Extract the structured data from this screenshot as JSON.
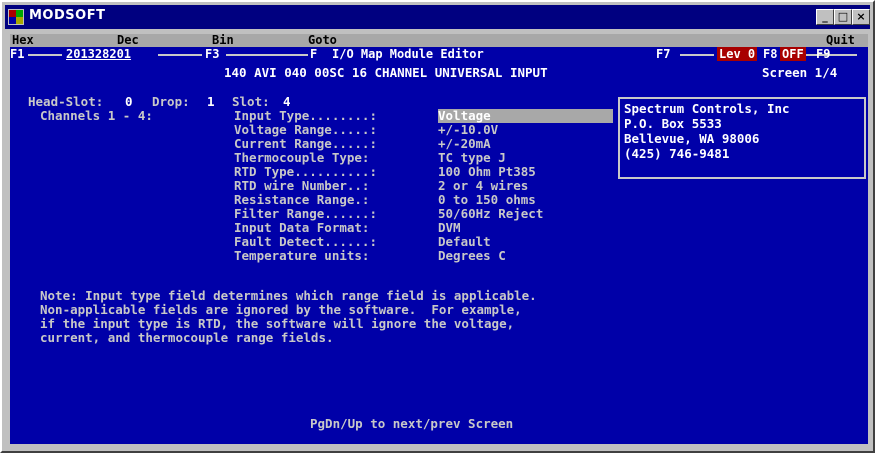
{
  "window": {
    "title": "MODSOFT",
    "minimize": "_",
    "maximize": "□",
    "close": "×"
  },
  "menu": {
    "hex": "Hex",
    "dec": "Dec",
    "bin": "Bin",
    "goto": "Goto",
    "quit": "Quit"
  },
  "keys": {
    "f1": "F1",
    "f1_value": "201328201",
    "f3": "F3",
    "f5": "F",
    "editor_title": "I/O Map Module Editor",
    "f7": "F7",
    "lev": "Lev 0",
    "f8": "F8",
    "off": "OFF",
    "f9": "F9"
  },
  "header": {
    "module": "140 AVI 040 00SC 16 CHANNEL UNIVERSAL INPUT",
    "screen": "Screen 1/4"
  },
  "location": {
    "head_slot_label": "Head-Slot:",
    "head_slot": "0",
    "drop_label": "Drop:",
    "drop": "1",
    "slot_label": "Slot:",
    "slot": "4",
    "channels": "Channels 1 - 4:"
  },
  "fields": [
    {
      "label": "Input Type........:",
      "value": "Voltage"
    },
    {
      "label": "Voltage Range.....:",
      "value": "+/-10.0V"
    },
    {
      "label": "Current Range.....:",
      "value": "+/-20mA"
    },
    {
      "label": "Thermocouple Type:",
      "value": "TC type J"
    },
    {
      "label": "RTD Type..........:",
      "value": "100 Ohm Pt385"
    },
    {
      "label": "RTD wire Number..:",
      "value": "2 or 4 wires"
    },
    {
      "label": "Resistance Range.:",
      "value": "0 to 150 ohms"
    },
    {
      "label": "Filter Range......:",
      "value": "50/60Hz Reject"
    },
    {
      "label": "Input Data Format:",
      "value": "DVM"
    },
    {
      "label": "Fault Detect......:",
      "value": "Default"
    },
    {
      "label": "Temperature units:",
      "value": "Degrees C"
    }
  ],
  "vendor": {
    "name": "Spectrum Controls, Inc",
    "po": "P.O. Box 5533",
    "city": "Bellevue, WA 98006",
    "phone": "(425) 746-9481"
  },
  "note": [
    "Note: Input type field determines which range field is applicable.",
    "Non-applicable fields are ignored by the software.  For example,",
    "if the input type is RTD, the software will ignore the voltage,",
    "current, and thermocouple range fields."
  ],
  "footer": "PgDn/Up to next/prev Screen"
}
